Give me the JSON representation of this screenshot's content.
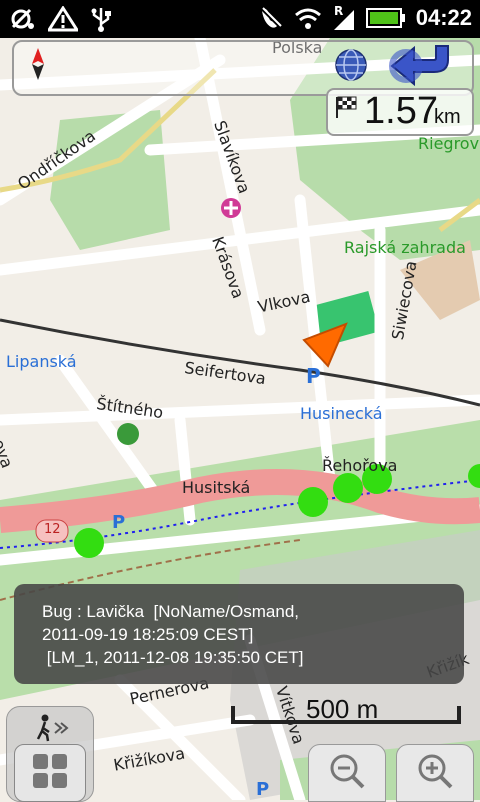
{
  "status": {
    "time": "04:22",
    "icons": [
      "osmand-icon",
      "warning-icon",
      "usb-icon",
      "mute-icon",
      "wifi-icon",
      "signal-roaming-icon",
      "battery-icon"
    ]
  },
  "map": {
    "street_labels": {
      "polska": "Polska",
      "slavikova": "Slavíkova",
      "ondrickova": "Ondříčkova",
      "riegrovy": "Riegrov",
      "rajska": "Rajská zahrada",
      "krasova": "Krásova",
      "vlkova": "Vlkova",
      "lipanska": "Lipanská",
      "seifertova": "Seifertova",
      "siwiecova": "Siwiecova",
      "husinecka": "Husinecká",
      "stitneho": "Štítného",
      "popova": "opova",
      "rehorova": "Řehořova",
      "husitska": "Husitská",
      "route_number": "12",
      "pernerova": "Pernerova",
      "krizikova": "Křižíkova",
      "vitkova": "Vítkova",
      "krizik": "Křižík"
    }
  },
  "navigation": {
    "distance_value": "1.57",
    "distance_unit": "km"
  },
  "popup": {
    "line1": "Bug : Lavička  [NoName/Osmand,",
    "line2": "2011-09-19 18:25:09 CEST]",
    "line3": " [LM_1, 2011-12-08 19:35:50 CET]"
  },
  "scale": {
    "label": "500 m"
  },
  "colors": {
    "map_bg": "#f2eee7",
    "green_area": "#b7dcaa",
    "main_road": "#ef9a98",
    "marker": "#ff6a00",
    "bug_dots": "#33dd11"
  }
}
